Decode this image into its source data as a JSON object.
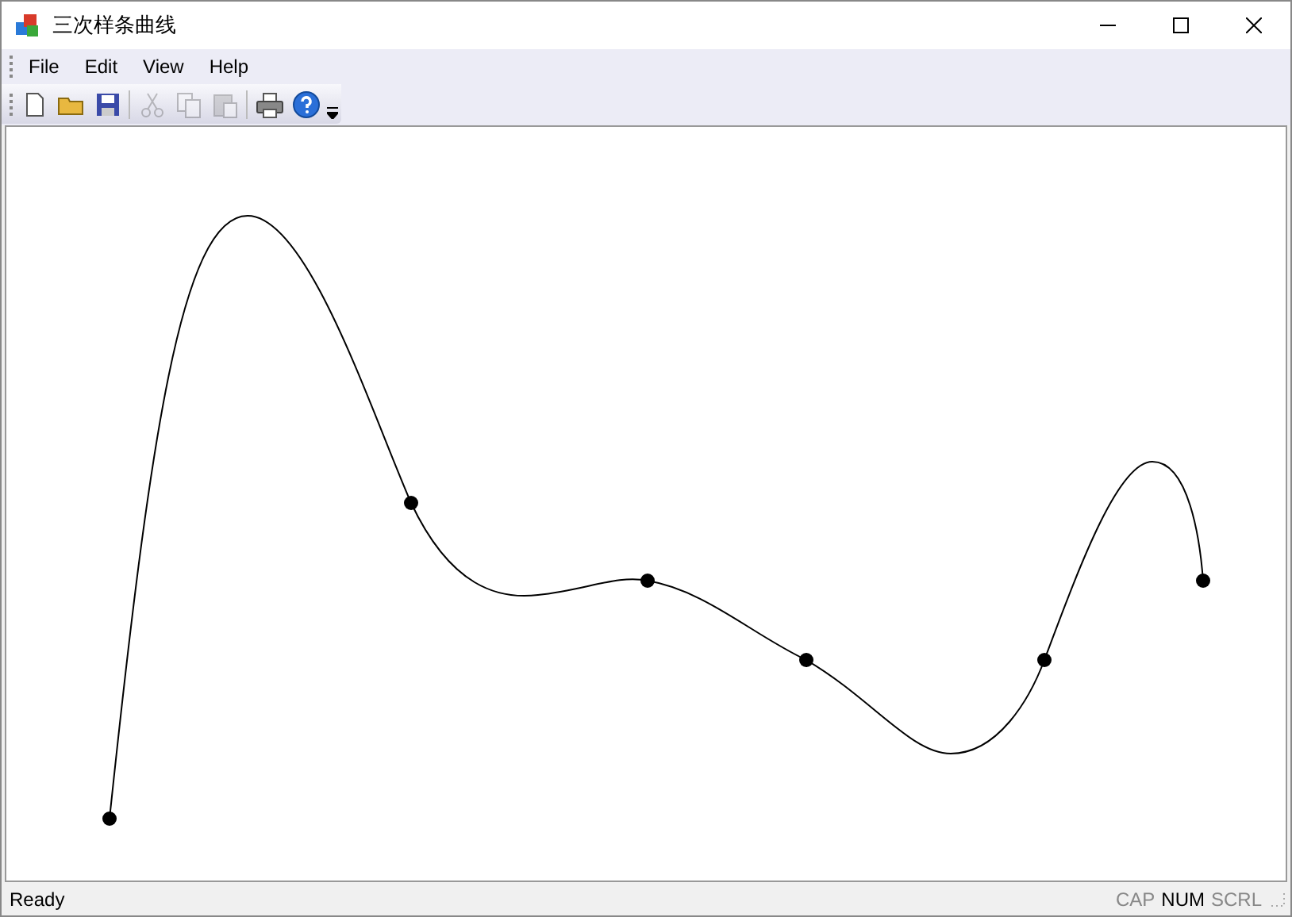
{
  "window": {
    "title": "三次样条曲线"
  },
  "menu": [
    "File",
    "Edit",
    "View",
    "Help"
  ],
  "toolbar": [
    {
      "kind": "new",
      "disabled": false
    },
    {
      "kind": "open",
      "disabled": false
    },
    {
      "kind": "save",
      "disabled": false
    },
    {
      "kind": "cut",
      "disabled": true
    },
    {
      "kind": "copy",
      "disabled": true
    },
    {
      "kind": "paste",
      "disabled": true
    },
    {
      "kind": "print",
      "disabled": false
    },
    {
      "kind": "help",
      "disabled": false
    }
  ],
  "status_bar": {
    "text": "Ready",
    "indicators": [
      {
        "label": "CAP",
        "on": false
      },
      {
        "label": "NUM",
        "on": true
      },
      {
        "label": "SCRL",
        "on": false
      }
    ]
  }
}
